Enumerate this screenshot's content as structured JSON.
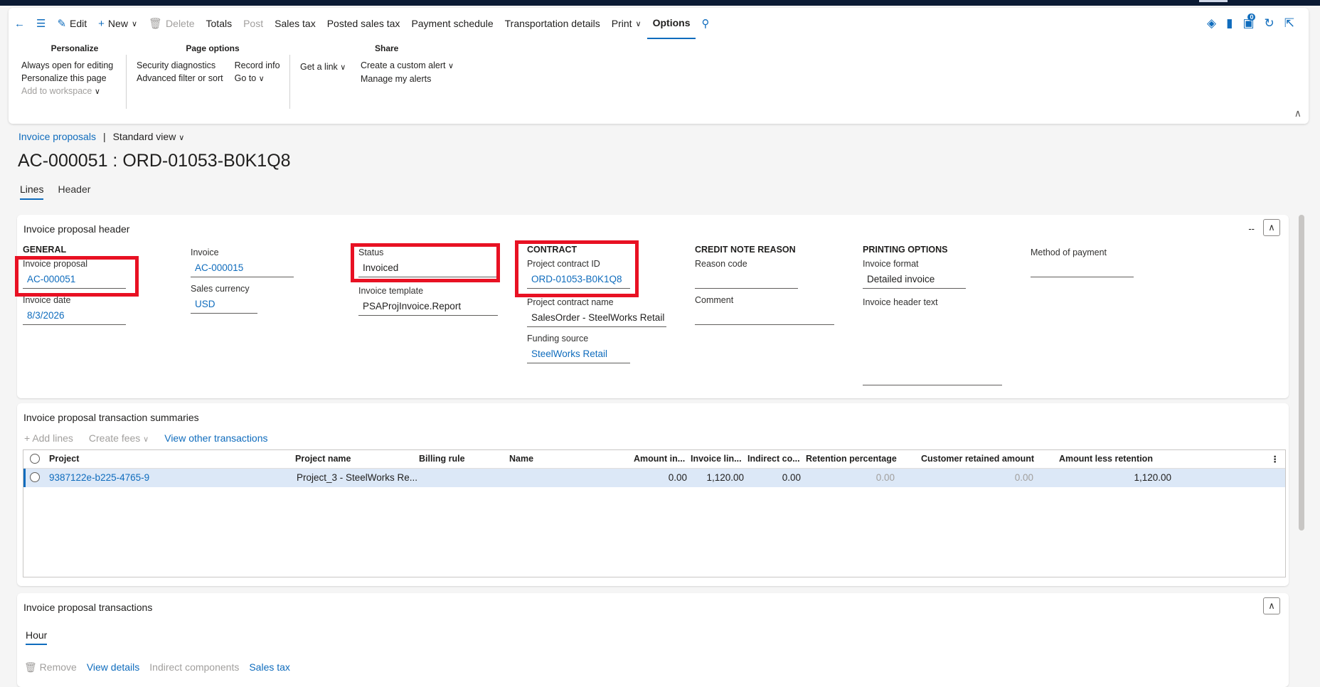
{
  "toolbar": {
    "edit": "Edit",
    "new": "New",
    "delete": "Delete",
    "totals": "Totals",
    "post": "Post",
    "sales_tax": "Sales tax",
    "posted_sales_tax": "Posted sales tax",
    "payment_schedule": "Payment schedule",
    "transportation_details": "Transportation details",
    "print": "Print",
    "options": "Options",
    "badge_count": "0"
  },
  "options_pane": {
    "personalize": {
      "title": "Personalize",
      "items": [
        "Always open for editing",
        "Personalize this page",
        "Add to workspace"
      ]
    },
    "page_options": {
      "title": "Page options",
      "col1": [
        "Security diagnostics",
        "Advanced filter or sort"
      ],
      "col2": [
        "Record info",
        "Go to"
      ]
    },
    "get_link": "Get a link",
    "share": {
      "title": "Share",
      "items": [
        "Create a custom alert",
        "Manage my alerts"
      ]
    }
  },
  "breadcrumb": {
    "link": "Invoice proposals",
    "view": "Standard view"
  },
  "page_title": "AC-000051 : ORD-01053-B0K1Q8",
  "tabs": [
    "Lines",
    "Header"
  ],
  "header_card": {
    "title": "Invoice proposal header",
    "dash": "--",
    "general": {
      "title": "GENERAL",
      "invoice_proposal_label": "Invoice proposal",
      "invoice_proposal": "AC-000051",
      "invoice_date_label": "Invoice date",
      "invoice_date": "8/3/2026"
    },
    "invoice": {
      "invoice_label": "Invoice",
      "invoice": "AC-000015",
      "currency_label": "Sales currency",
      "currency": "USD"
    },
    "status": {
      "status_label": "Status",
      "status": "Invoiced",
      "template_label": "Invoice template",
      "template": "PSAProjInvoice.Report"
    },
    "contract": {
      "title": "CONTRACT",
      "id_label": "Project contract ID",
      "id": "ORD-01053-B0K1Q8",
      "name_label": "Project contract name",
      "name": "SalesOrder - SteelWorks Retail",
      "funding_label": "Funding source",
      "funding": "SteelWorks Retail"
    },
    "credit_note": {
      "title": "CREDIT NOTE REASON",
      "reason_label": "Reason code",
      "reason": "",
      "comment_label": "Comment",
      "comment": ""
    },
    "printing": {
      "title": "PRINTING OPTIONS",
      "format_label": "Invoice format",
      "format": "Detailed invoice",
      "header_text_label": "Invoice header text",
      "header_text": ""
    },
    "payment": {
      "method_label": "Method of payment",
      "method": ""
    }
  },
  "summaries": {
    "title": "Invoice proposal transaction summaries",
    "add_lines": "Add lines",
    "create_fees": "Create fees",
    "view_other": "View other transactions",
    "columns": [
      "Project",
      "Project name",
      "Billing rule",
      "Name",
      "Amount in...",
      "Invoice lin...",
      "Indirect co...",
      "Retention percentage",
      "Customer retained amount",
      "Amount less retention"
    ],
    "rows": [
      {
        "project": "9387122e-b225-4765-9",
        "project_name": "Project_3 - SteelWorks Re...",
        "billing_rule": "",
        "name": "",
        "amount_in": "0.00",
        "invoice_line": "1,120.00",
        "indirect": "0.00",
        "retention_pct": "0.00",
        "customer_retained": "0.00",
        "amount_less": "1,120.00"
      }
    ]
  },
  "transactions": {
    "title": "Invoice proposal transactions",
    "tab": "Hour",
    "remove": "Remove",
    "view_details": "View details",
    "indirect_components": "Indirect components",
    "sales_tax": "Sales tax"
  }
}
